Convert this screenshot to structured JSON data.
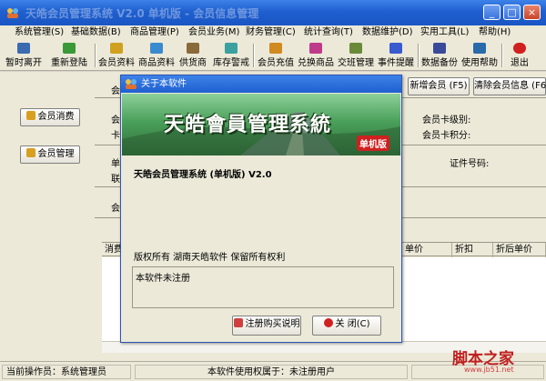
{
  "window": {
    "title": "天皓会员管理系统 V2.0 单机版 - 会员信息管理"
  },
  "menu": [
    {
      "label": "系统管理(S)"
    },
    {
      "label": "基础数据(B)"
    },
    {
      "label": "商品管理(P)"
    },
    {
      "label": "会员业务(M)"
    },
    {
      "label": "财务管理(C)"
    },
    {
      "label": "统计查询(T)"
    },
    {
      "label": "数据维护(D)"
    },
    {
      "label": "实用工具(L)"
    },
    {
      "label": "帮助(H)"
    }
  ],
  "toolbar": [
    {
      "label": "暂时离开",
      "icon": "leave-icon",
      "color": "#3a6ab0"
    },
    {
      "label": "重新登陆",
      "icon": "login-icon",
      "color": "#3a9a3a"
    },
    {
      "label": "会员资料",
      "icon": "member-info-icon",
      "color": "#d0a020"
    },
    {
      "label": "商品资料",
      "icon": "goods-icon",
      "color": "#3a8ad0"
    },
    {
      "label": "供货商",
      "icon": "supplier-icon",
      "color": "#8a6a3a"
    },
    {
      "label": "库存警戒",
      "icon": "stock-alert-icon",
      "color": "#3aa0a0"
    },
    {
      "label": "会员充值",
      "icon": "recharge-icon",
      "color": "#d08a20"
    },
    {
      "label": "兑换商品",
      "icon": "exchange-icon",
      "color": "#c03a8a"
    },
    {
      "label": "交班管理",
      "icon": "shift-icon",
      "color": "#6a8a3a"
    },
    {
      "label": "事件提醒",
      "icon": "reminder-icon",
      "color": "#3a5ad0"
    },
    {
      "label": "数据备份",
      "icon": "backup-icon",
      "color": "#3a4a9a"
    },
    {
      "label": "使用帮助",
      "icon": "help-icon",
      "color": "#2a6aaa"
    },
    {
      "label": "退出",
      "icon": "exit-icon",
      "color": "#d02020"
    }
  ],
  "sidebar": {
    "consume_label": "会员消费",
    "manage_label": "会员管理"
  },
  "content": {
    "btn_new_member": "新增会员 (F5)",
    "btn_clear_member": "清除会员信息 (F6",
    "label_card_level": "会员卡级别:",
    "label_card_points": "会员卡积分:",
    "label_id_number": "证件号码:",
    "frag_1": "会",
    "frag_2": "会",
    "frag_3": "卡",
    "frag_4": "单",
    "frag_5": "联",
    "frag_6": "会"
  },
  "table": {
    "columns": [
      "消费",
      "单价",
      "折扣",
      "折后单价"
    ]
  },
  "status": {
    "operator": "当前操作员：系统管理员",
    "license": "本软件使用权属于：未注册用户"
  },
  "dialog": {
    "title": "关于本软件",
    "banner_title": "天皓會員管理系統",
    "banner_badge": "单机版",
    "product_line": "天皓会员管理系统 (单机版) V2.0",
    "copyright": "版权所有    湖南天皓软件  保留所有权利",
    "registration_status": "本软件未注册",
    "btn_register": "注册购买说明",
    "btn_close": "关  闭(C)"
  },
  "watermark": {
    "text": "脚本之家",
    "url": "www.jb51.net"
  }
}
